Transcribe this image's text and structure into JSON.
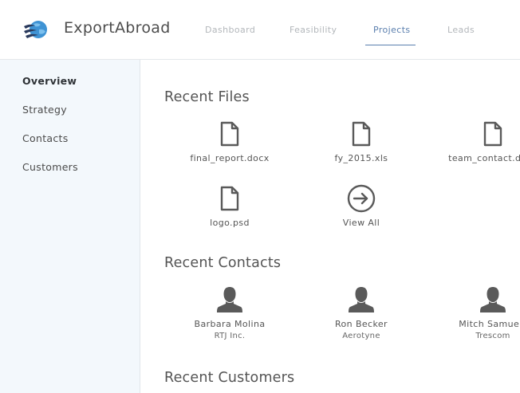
{
  "app": {
    "name": "ExportAbroad",
    "logo_icon": "globe-logo-icon"
  },
  "nav": {
    "tabs": [
      {
        "label": "Dashboard",
        "active": false
      },
      {
        "label": "Feasibility",
        "active": false
      },
      {
        "label": "Projects",
        "active": true
      },
      {
        "label": "Leads",
        "active": false
      }
    ],
    "active_color": "#5b7fae"
  },
  "sidebar": {
    "items": [
      {
        "label": "Overview",
        "active": true
      },
      {
        "label": "Strategy",
        "active": false
      },
      {
        "label": "Contacts",
        "active": false
      },
      {
        "label": "Customers",
        "active": false
      }
    ]
  },
  "main": {
    "recent_files": {
      "title": "Recent Files",
      "files": [
        {
          "name": "final_report.docx",
          "icon": "file-icon"
        },
        {
          "name": "fy_2015.xls",
          "icon": "file-icon"
        },
        {
          "name": "team_contact.docx",
          "icon": "file-icon"
        },
        {
          "name": "logo.psd",
          "icon": "file-icon"
        }
      ],
      "view_all": {
        "label": "View All",
        "icon": "arrow-circle-right-icon"
      }
    },
    "recent_contacts": {
      "title": "Recent Contacts",
      "contacts": [
        {
          "name": "Barbara Molina",
          "company": "RTJ Inc.",
          "icon": "person-icon"
        },
        {
          "name": "Ron Becker",
          "company": "Aerotyne",
          "icon": "person-icon"
        },
        {
          "name": "Mitch Samuels",
          "company": "Trescom",
          "icon": "person-icon"
        }
      ]
    },
    "recent_customers": {
      "title": "Recent Customers"
    }
  },
  "colors": {
    "sidebar_bg": "#f3f8fc",
    "icon": "#5a5a5a",
    "accent": "#5b7fae"
  }
}
